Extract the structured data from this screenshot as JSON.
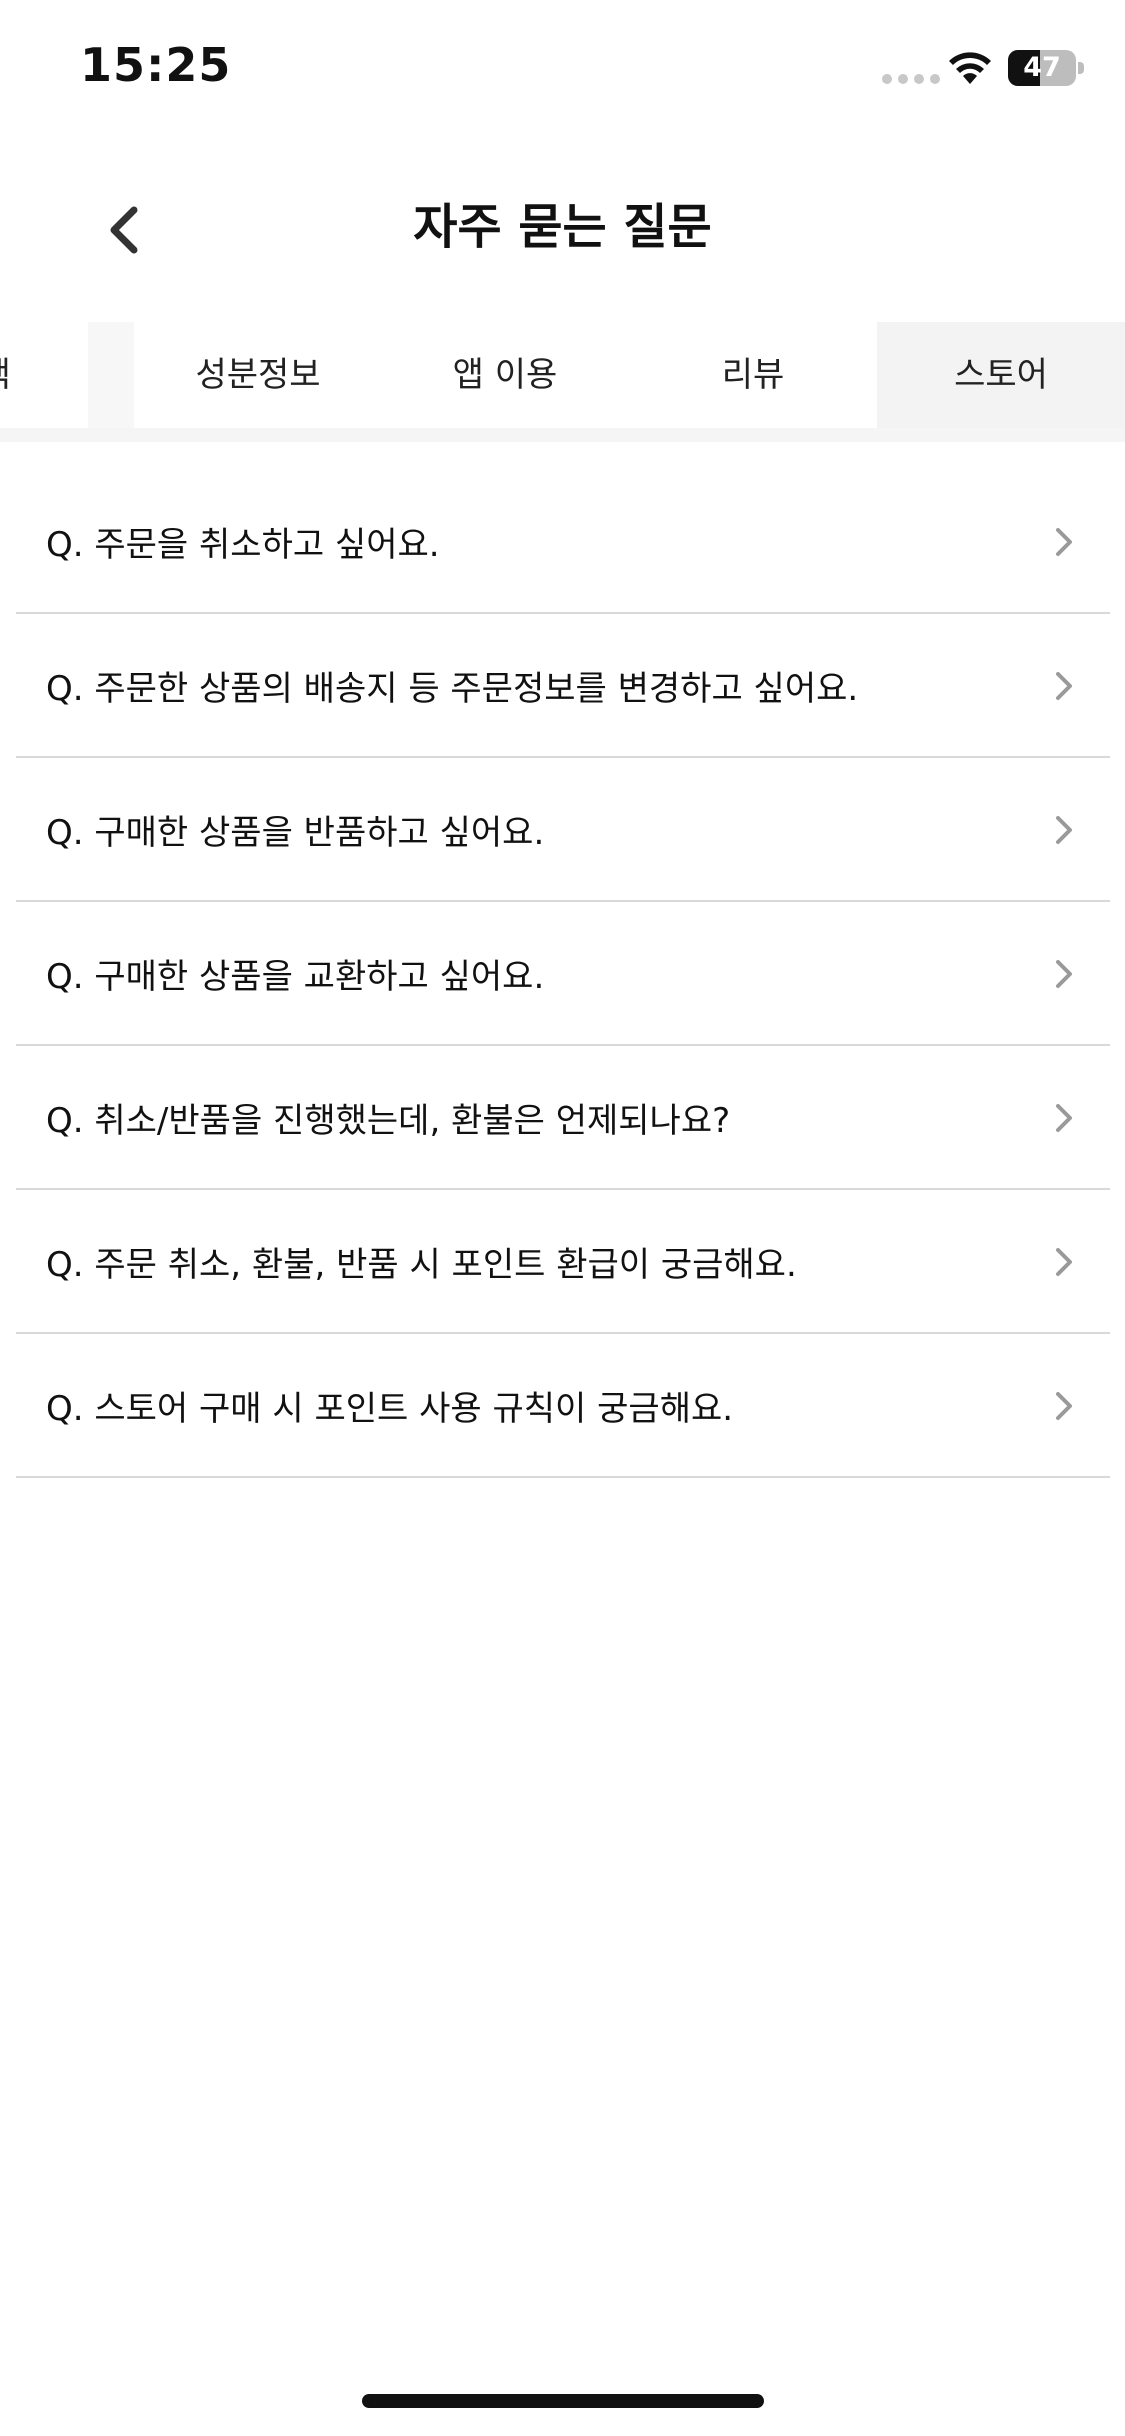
{
  "status_bar": {
    "time": "15:25",
    "battery": "47",
    "battery_level": 0.47
  },
  "header": {
    "title": "자주 묻는 질문",
    "back_icon": "chevron-left-icon"
  },
  "tabs": [
    {
      "label": "정정책",
      "active": false
    },
    {
      "label": "성분정보",
      "active": false
    },
    {
      "label": "앱 이용",
      "active": false
    },
    {
      "label": "리뷰",
      "active": false
    },
    {
      "label": "스토어",
      "active": true
    }
  ],
  "faq": [
    {
      "question": "Q. 주문을 취소하고 싶어요."
    },
    {
      "question": "Q. 주문한 상품의 배송지 등 주문정보를 변경하고 싶어요."
    },
    {
      "question": "Q. 구매한 상품을 반품하고 싶어요."
    },
    {
      "question": "Q. 구매한 상품을 교환하고 싶어요."
    },
    {
      "question": "Q. 취소/반품을 진행했는데, 환불은 언제되나요?"
    },
    {
      "question": "Q. 주문 취소, 환불, 반품 시 포인트 환급이 궁금해요."
    },
    {
      "question": "Q. 스토어 구매 시 포인트 사용 규칙이 궁금해요."
    }
  ]
}
